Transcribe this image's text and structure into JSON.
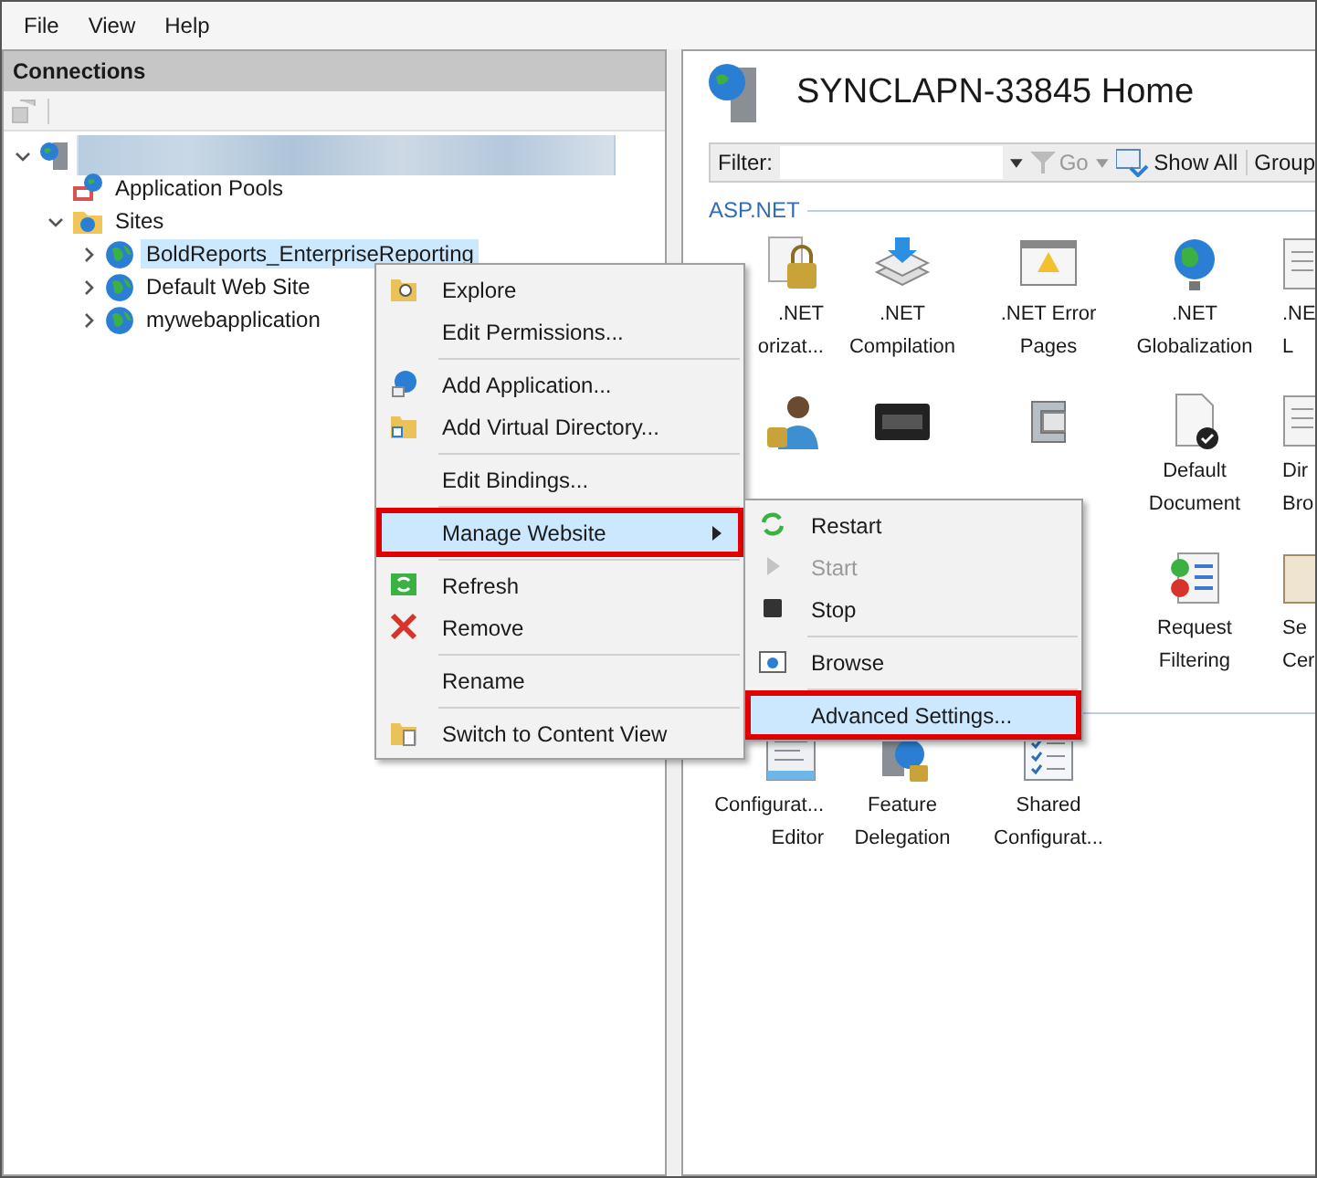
{
  "menu_bar": [
    "File",
    "View",
    "Help"
  ],
  "connections": {
    "title": "Connections",
    "tree": [
      {
        "kind": "server",
        "expanded": true,
        "selected": false,
        "children": [
          {
            "kind": "pools",
            "label": "Application Pools",
            "selected": false
          },
          {
            "kind": "sites",
            "label": "Sites",
            "expanded": true,
            "selected": false,
            "children": [
              {
                "kind": "site",
                "label": "BoldReports_EnterpriseReporting",
                "expanded": false,
                "selected": true
              },
              {
                "kind": "site",
                "label": "Default Web Site",
                "expanded": false,
                "selected": false
              },
              {
                "kind": "site",
                "label": "mywebapplication",
                "expanded": false,
                "selected": false
              }
            ]
          }
        ]
      }
    ]
  },
  "home": {
    "title": "SYNCLAPN-33845 Home",
    "filter": {
      "label": "Filter:",
      "go": "Go",
      "show_all": "Show All",
      "group": "Group"
    },
    "groups": [
      {
        "title": "ASP.NET",
        "features": [
          {
            "kind": "lockdoc",
            "lines": [
              ".NET",
              "orizat..."
            ]
          },
          {
            "kind": "stack",
            "lines": [
              ".NET",
              "Compilation"
            ]
          },
          {
            "kind": "errorpage",
            "lines": [
              ".NET Error",
              "Pages"
            ]
          },
          {
            "kind": "globe",
            "lines": [
              ".NET",
              "Globalization"
            ]
          },
          {
            "kind": "doc",
            "lines": [
              ".NE",
              "L"
            ]
          },
          {
            "kind": "personlock"
          },
          {
            "kind": "cgi"
          },
          {
            "kind": "compression"
          },
          {
            "kind": "defaultdoc",
            "lines": [
              "Default",
              "Document"
            ]
          },
          {
            "kind": "doc",
            "lines": [
              "Dir",
              "Bro"
            ]
          },
          {
            "kind": "none"
          },
          {
            "kind": "none"
          },
          {
            "kind": "none"
          },
          {
            "kind": "requestfilter",
            "lines": [
              "Request",
              "Filtering"
            ]
          },
          {
            "kind": "cert",
            "lines": [
              "Se",
              "Cer"
            ]
          }
        ]
      },
      {
        "features": [
          {
            "kind": "configeditor",
            "lines": [
              "Configurat...",
              "Editor"
            ]
          },
          {
            "kind": "delegation",
            "lines": [
              "Feature",
              "Delegation"
            ]
          },
          {
            "kind": "sharedconfig",
            "lines": [
              "Shared",
              "Configurat..."
            ]
          }
        ]
      }
    ]
  },
  "context_menu": [
    {
      "kind": "explore",
      "label": "Explore",
      "selected": false
    },
    {
      "kind": "plain",
      "label": "Edit Permissions...",
      "selected": false
    },
    {
      "kind": "separator"
    },
    {
      "kind": "app",
      "label": "Add Application...",
      "selected": false
    },
    {
      "kind": "vdir",
      "label": "Add Virtual Directory...",
      "selected": false
    },
    {
      "kind": "separator"
    },
    {
      "kind": "plain",
      "label": "Edit Bindings...",
      "selected": false
    },
    {
      "kind": "separator"
    },
    {
      "kind": "submenu",
      "label": "Manage Website",
      "selected": true
    },
    {
      "kind": "separator"
    },
    {
      "kind": "refresh",
      "label": "Refresh",
      "selected": false
    },
    {
      "kind": "remove",
      "label": "Remove",
      "selected": false
    },
    {
      "kind": "separator"
    },
    {
      "kind": "plain",
      "label": "Rename",
      "selected": false
    },
    {
      "kind": "separator"
    },
    {
      "kind": "content",
      "label": "Switch to Content View",
      "selected": false
    }
  ],
  "submenu": [
    {
      "kind": "restart",
      "label": "Restart",
      "disabled": false,
      "selected": false
    },
    {
      "kind": "start",
      "label": "Start",
      "disabled": true,
      "selected": false
    },
    {
      "kind": "stop",
      "label": "Stop",
      "disabled": false,
      "selected": false
    },
    {
      "kind": "separator"
    },
    {
      "kind": "browse",
      "label": "Browse",
      "disabled": false,
      "selected": false
    },
    {
      "kind": "separator"
    },
    {
      "kind": "plain",
      "label": "Advanced Settings...",
      "disabled": false,
      "selected": true
    }
  ]
}
